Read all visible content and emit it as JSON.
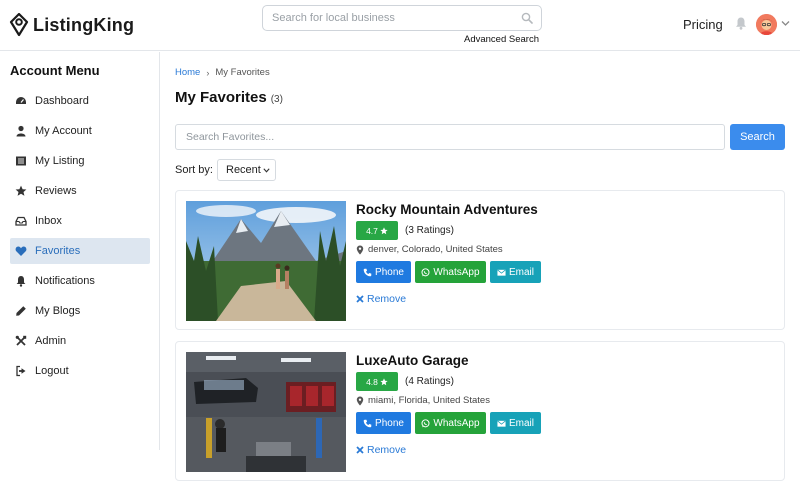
{
  "header": {
    "logo_text": "ListingKing",
    "search_placeholder": "Search for local business",
    "advanced_search": "Advanced Search",
    "pricing": "Pricing"
  },
  "sidebar": {
    "title": "Account Menu",
    "items": [
      {
        "label": "Dashboard",
        "icon": "dashboard-icon"
      },
      {
        "label": "My Account",
        "icon": "user-icon"
      },
      {
        "label": "My Listing",
        "icon": "list-icon"
      },
      {
        "label": "Reviews",
        "icon": "star-icon"
      },
      {
        "label": "Inbox",
        "icon": "inbox-icon"
      },
      {
        "label": "Favorites",
        "icon": "heart-icon",
        "active": true
      },
      {
        "label": "Notifications",
        "icon": "bell-icon"
      },
      {
        "label": "My Blogs",
        "icon": "pencil-icon"
      },
      {
        "label": "Admin",
        "icon": "tools-icon"
      },
      {
        "label": "Logout",
        "icon": "logout-icon"
      }
    ]
  },
  "main": {
    "breadcrumb": {
      "home": "Home",
      "separator": "›",
      "current": "My Favorites"
    },
    "title": "My Favorites",
    "count": "(3)",
    "search_placeholder": "Search Favorites...",
    "search_button": "Search",
    "sort_label": "Sort by:",
    "sort_value": "Recent",
    "listings": [
      {
        "name": "Rocky Mountain Adventures",
        "rating": "4.7",
        "ratings_count": "(3 Ratings)",
        "location": "denver, Colorado, United States",
        "phone_label": "Phone",
        "whatsapp_label": "WhatsApp",
        "email_label": "Email",
        "remove_label": "Remove"
      },
      {
        "name": "LuxeAuto Garage",
        "rating": "4.8",
        "ratings_count": "(4 Ratings)",
        "location": "miami, Florida, United States",
        "phone_label": "Phone",
        "whatsapp_label": "WhatsApp",
        "email_label": "Email",
        "remove_label": "Remove"
      }
    ]
  },
  "colors": {
    "primary": "#3b8ced",
    "link": "#2a7ad6",
    "success": "#28a745",
    "whatsapp": "#25a33a",
    "info": "#17a2b8",
    "active_bg": "#dde6f0"
  }
}
